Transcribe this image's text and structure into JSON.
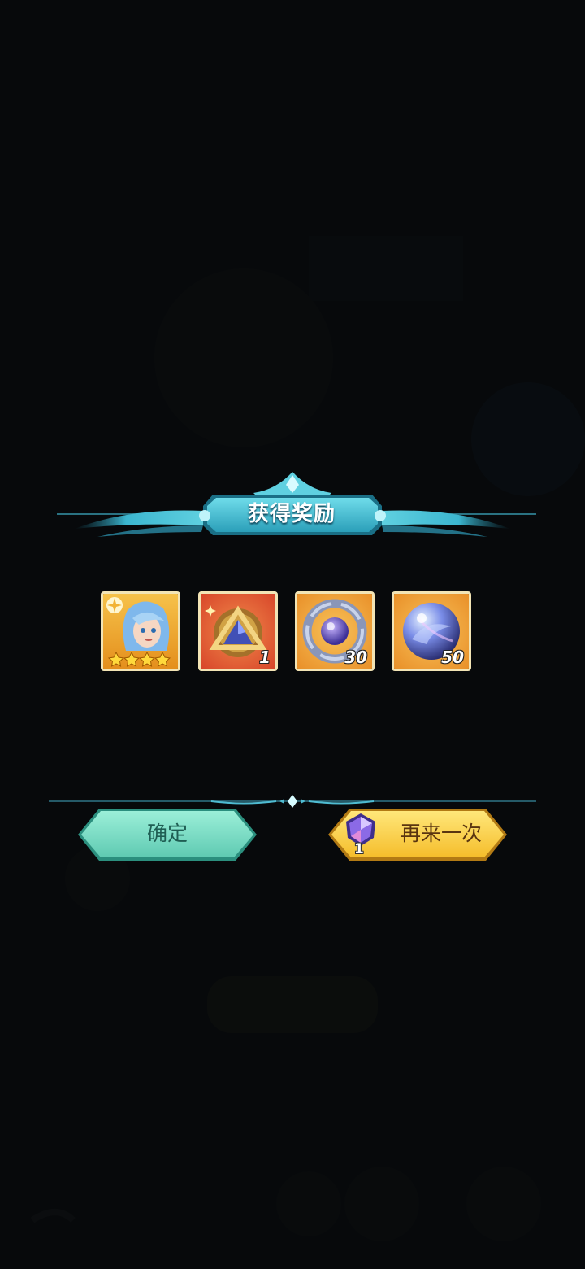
{
  "popup": {
    "title": "获得奖励"
  },
  "rewards": [
    {
      "name": "hero-card",
      "qty": "",
      "stars": 4
    },
    {
      "name": "golden-triangle-badge",
      "qty": "1"
    },
    {
      "name": "arcane-ring-orb",
      "qty": "30"
    },
    {
      "name": "blue-swirl-orb",
      "qty": "50"
    }
  ],
  "buttons": {
    "confirm_label": "确定",
    "again_label": "再来一次",
    "again_cost_qty": "1"
  },
  "colors": {
    "accent_teal": "#57c9d8",
    "confirm_button": "#7fe0c8",
    "again_button": "#fbd54a"
  }
}
